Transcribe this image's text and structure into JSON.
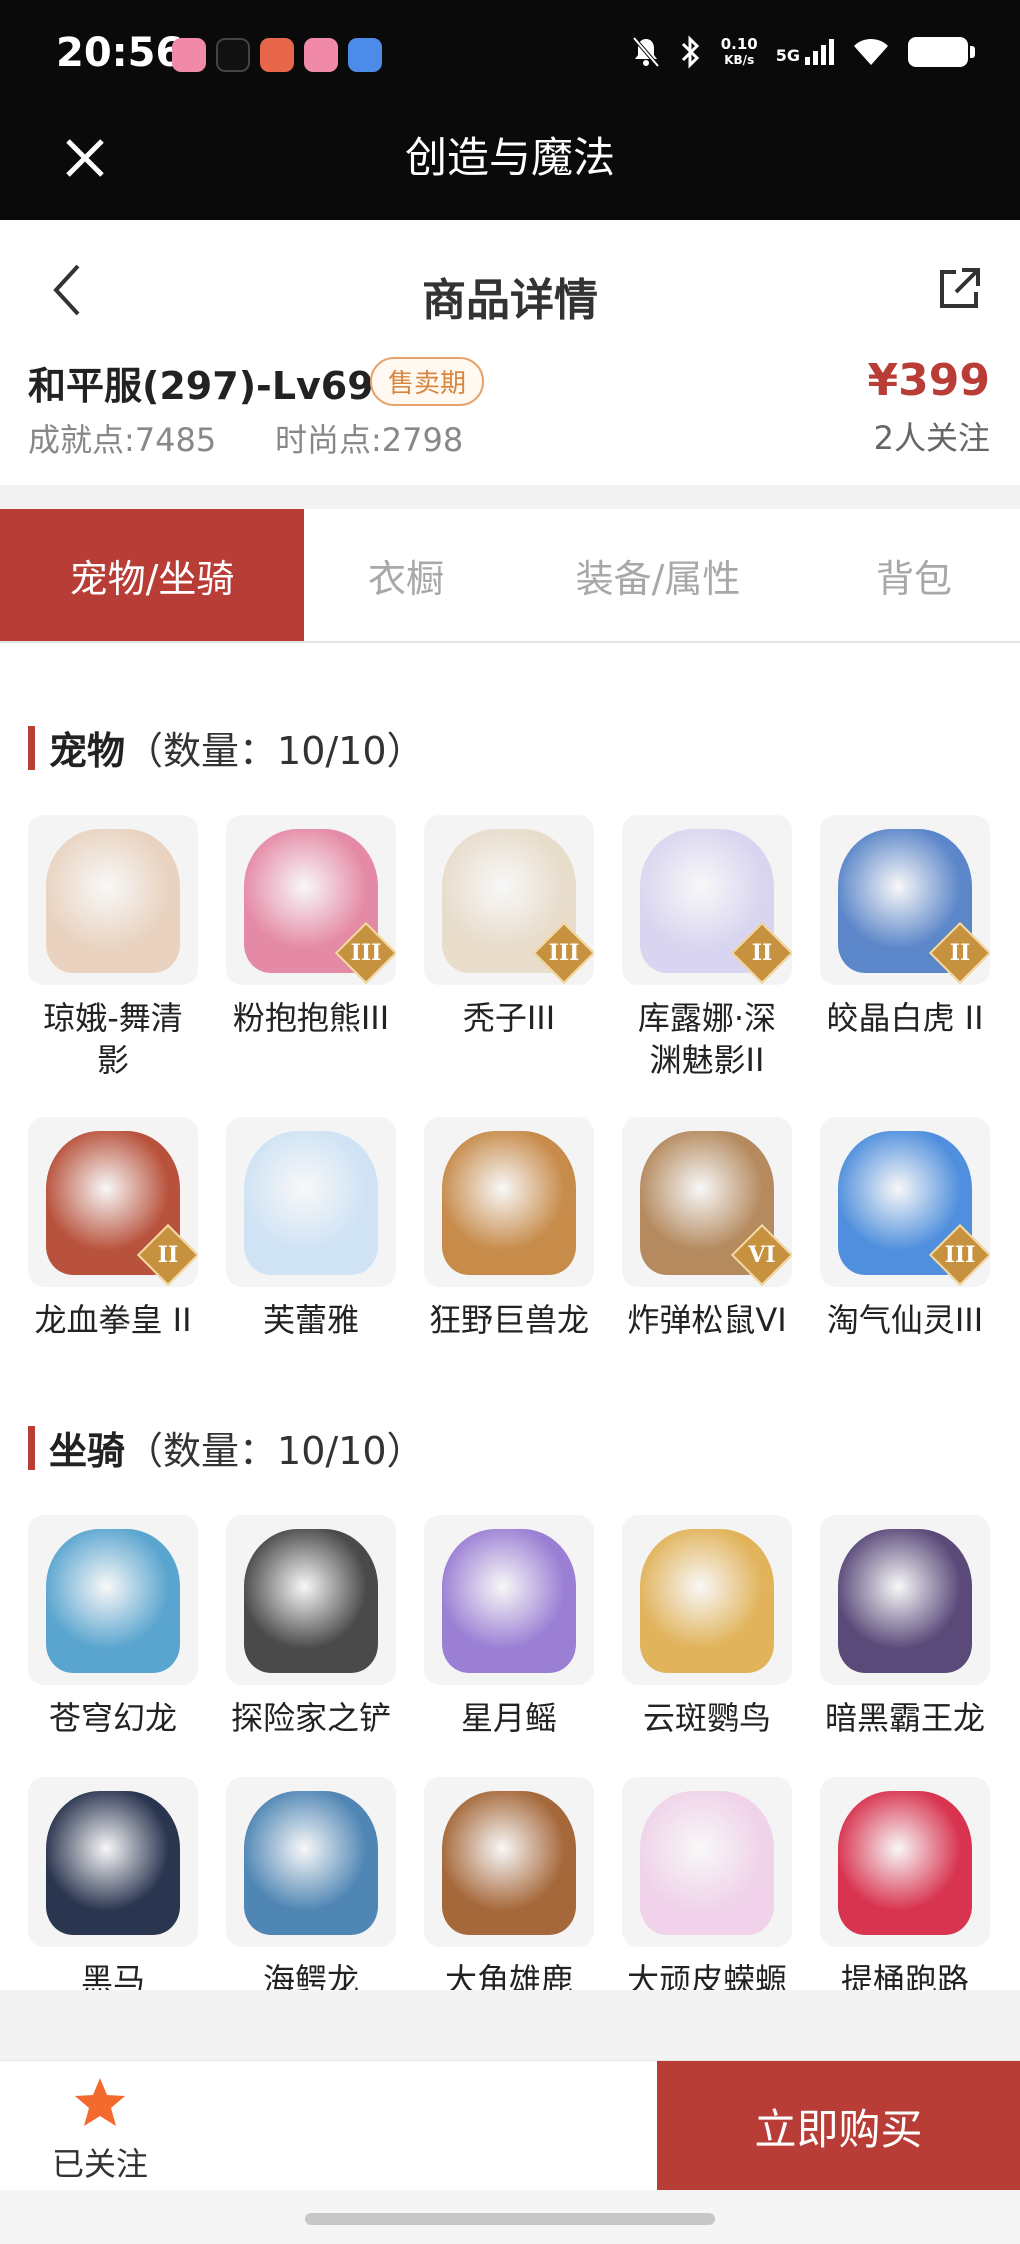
{
  "status_bar": {
    "time": "20:56",
    "speed_value": "0.10",
    "speed_unit": "KB/s",
    "network": "5G",
    "app_icons": [
      "bilibili-icon",
      "tiktok-icon",
      "game-icon",
      "bilibili-icon",
      "app-icon"
    ]
  },
  "app_bar": {
    "title": "创造与魔法"
  },
  "header": {
    "title": "商品详情"
  },
  "product": {
    "name": "和平服(297)-Lv69",
    "badge": "售卖期",
    "achievement": "成就点:7485",
    "fashion": "时尚点:2798",
    "price": "¥399",
    "followers": "2人关注"
  },
  "tabs": [
    {
      "label": "宠物/坐骑",
      "active": true
    },
    {
      "label": "衣橱",
      "active": false
    },
    {
      "label": "装备/属性",
      "active": false
    },
    {
      "label": "背包",
      "active": false
    }
  ],
  "pets_section": {
    "title": "宠物",
    "count": "（数量：10/10）"
  },
  "pets": [
    {
      "label": "琼娥-舞清影",
      "tier": "",
      "color": "#e9d3c0"
    },
    {
      "label": "粉抱抱熊III",
      "tier": "III",
      "color": "#e58aa6"
    },
    {
      "label": "秃子III",
      "tier": "III",
      "color": "#e8dccb"
    },
    {
      "label": "库露娜·深渊魅影II",
      "tier": "II",
      "color": "#d9d5f0"
    },
    {
      "label": "皎晶白虎 II",
      "tier": "II",
      "color": "#5b86c9"
    },
    {
      "label": "龙血拳皇 II",
      "tier": "II",
      "color": "#b8523c"
    },
    {
      "label": "芙蕾雅",
      "tier": "",
      "color": "#cfe3f5"
    },
    {
      "label": "狂野巨兽龙",
      "tier": "",
      "color": "#c78b4a"
    },
    {
      "label": "炸弹松鼠VI",
      "tier": "VI",
      "color": "#b48a5e"
    },
    {
      "label": "淘气仙灵III",
      "tier": "III",
      "color": "#4f8fdd"
    }
  ],
  "mounts_section": {
    "title": "坐骑",
    "count": "（数量：10/10）"
  },
  "mounts": [
    {
      "label": "苍穹幻龙",
      "color": "#5aa5cf"
    },
    {
      "label": "探险家之铲",
      "color": "#4a4a4a"
    },
    {
      "label": "星月鳐",
      "color": "#9b7fd4"
    },
    {
      "label": "云斑鹦鸟",
      "color": "#e1b35a"
    },
    {
      "label": "暗黑霸王龙",
      "color": "#5a4a7a"
    },
    {
      "label": "黑马",
      "color": "#2a3550"
    },
    {
      "label": "海鳄龙",
      "color": "#4f86b4"
    },
    {
      "label": "大角雄鹿",
      "color": "#a5683a"
    },
    {
      "label": "大顽皮蝾螈",
      "color": "#f0d3ea"
    },
    {
      "label": "提桶跑路",
      "color": "#d8334f"
    }
  ],
  "bottom": {
    "follow_label": "已关注",
    "buy_label": "立即购买"
  },
  "colors": {
    "accent": "#b83d36",
    "badge": "#d9863f",
    "star": "#f26a2e"
  }
}
